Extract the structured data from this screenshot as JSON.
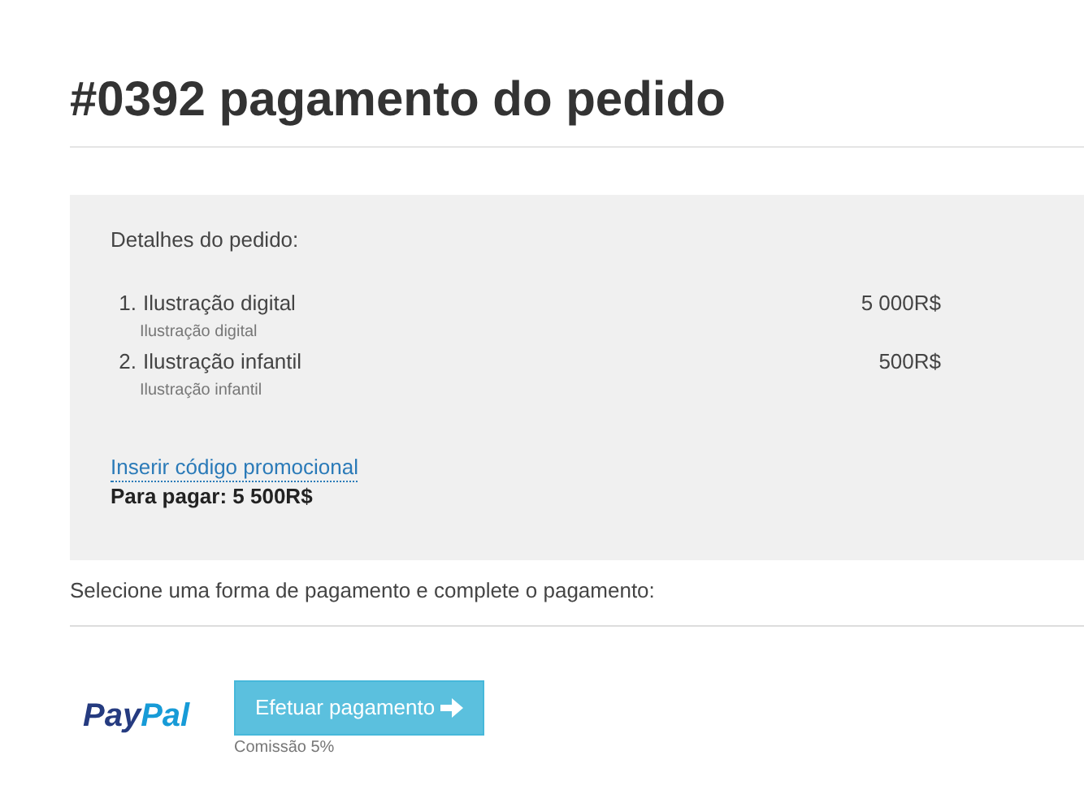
{
  "title": "#0392 pagamento do pedido",
  "order": {
    "heading": "Detalhes do pedido:",
    "items": [
      {
        "number": "1.",
        "name": "Ilustração digital",
        "description": "Ilustração digital",
        "price": "5 000R$"
      },
      {
        "number": "2.",
        "name": "Ilustração infantil",
        "description": "Ilustração infantil",
        "price": "500R$"
      }
    ],
    "promo_link": "Inserir código promocional",
    "total": "Para pagar: 5 500R$"
  },
  "instruction": "Selecione uma forma de pagamento e complete o pagamento:",
  "payment": {
    "logo_parts": [
      "Pay",
      "Pal"
    ],
    "button": "Efetuar pagamento",
    "commission": "Comissão 5%"
  }
}
